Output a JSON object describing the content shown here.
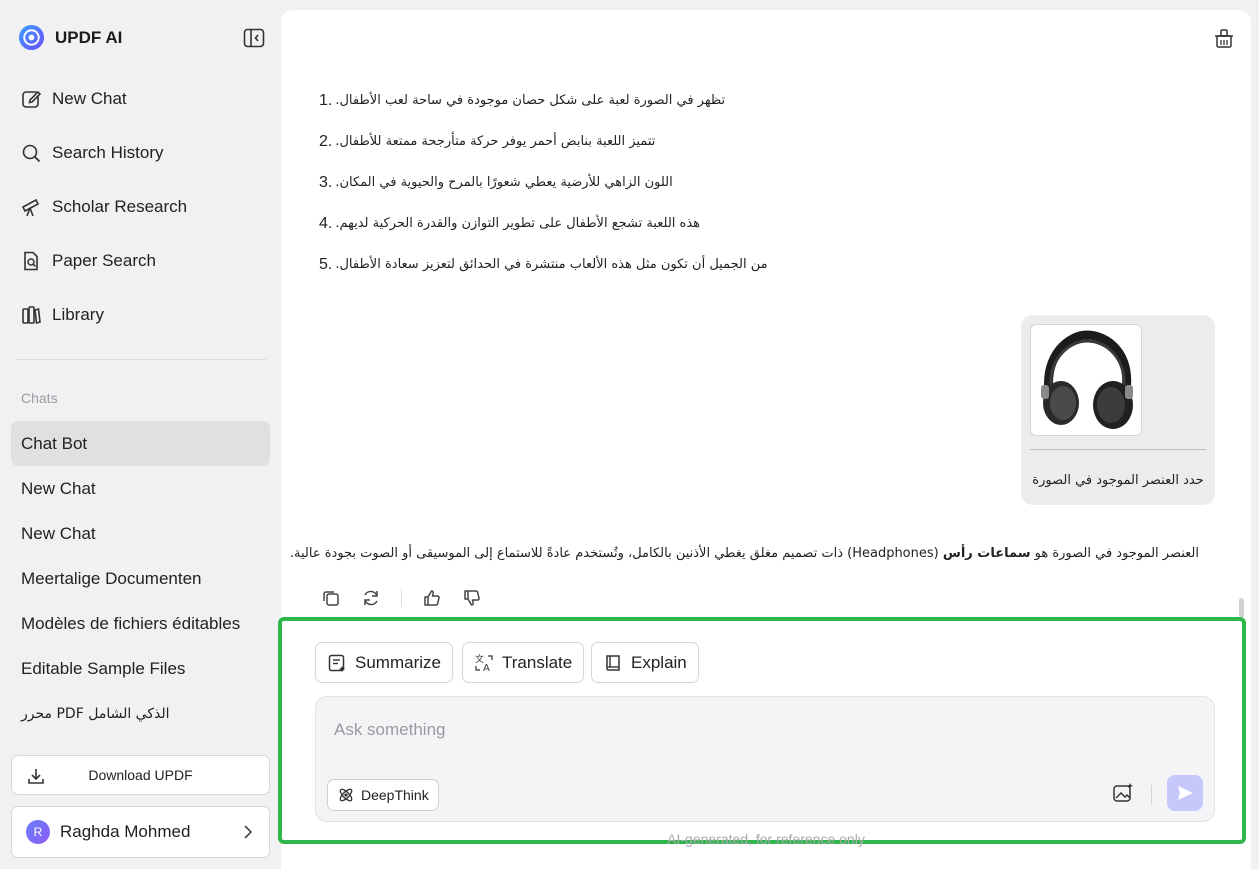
{
  "brand": {
    "name": "UPDF AI"
  },
  "nav": [
    {
      "label": "New Chat",
      "icon": "edit-icon"
    },
    {
      "label": "Search History",
      "icon": "search-icon"
    },
    {
      "label": "Scholar Research",
      "icon": "telescope-icon"
    },
    {
      "label": "Paper Search",
      "icon": "document-search-icon"
    },
    {
      "label": "Library",
      "icon": "library-icon"
    }
  ],
  "chats": {
    "label": "Chats",
    "items": [
      {
        "label": "Chat Bot",
        "active": true
      },
      {
        "label": "New Chat"
      },
      {
        "label": "New Chat"
      },
      {
        "label": "Meertalige Documenten"
      },
      {
        "label": "Modèles de fichiers éditables"
      },
      {
        "label": "Editable Sample Files"
      },
      {
        "label": "محرر PDF الذكي الشامل"
      }
    ]
  },
  "download": {
    "label": "Download UPDF"
  },
  "user": {
    "initial": "R",
    "name": "Raghda Mohmed"
  },
  "conversation": {
    "answer_items": [
      {
        "num": "1.",
        "text": "تظهر في الصورة لعبة على شكل حصان موجودة في ساحة لعب الأطفال."
      },
      {
        "num": "2.",
        "text": "تتميز اللعبة بنابض أحمر يوفر حركة متأرجحة ممتعة للأطفال."
      },
      {
        "num": "3.",
        "text": "اللون الزاهي للأرضية يعطي شعورًا بالمرح والحيوية في المكان."
      },
      {
        "num": "4.",
        "text": "هذه اللعبة تشجع الأطفال على تطوير التوازن والقدرة الحركية لديهم."
      },
      {
        "num": "5.",
        "text": "من الجميل أن تكون مثل هذه الألعاب منتشرة في الحدائق لتعزيز سعادة الأطفال."
      }
    ],
    "user_message": "حدد العنصر الموجود في الصورة",
    "reply_before": "العنصر الموجود في الصورة هو ",
    "reply_bold": "سماعات رأس",
    "reply_after": " (Headphones) ذات تصميم مغلق يغطي الأذنين بالكامل، وتُستخدم عادةً للاستماع إلى الموسيقى أو الصوت بجودة عالية."
  },
  "quick_actions": {
    "summarize": "Summarize",
    "translate": "Translate",
    "explain": "Explain"
  },
  "composer": {
    "placeholder": "Ask something",
    "deepthink": "DeepThink"
  },
  "footnote": "AI-generated, for reference only",
  "colors": {
    "highlight": "#2fb74c",
    "send_button": "#c6c8fb",
    "brand": "#3d6cf0"
  }
}
